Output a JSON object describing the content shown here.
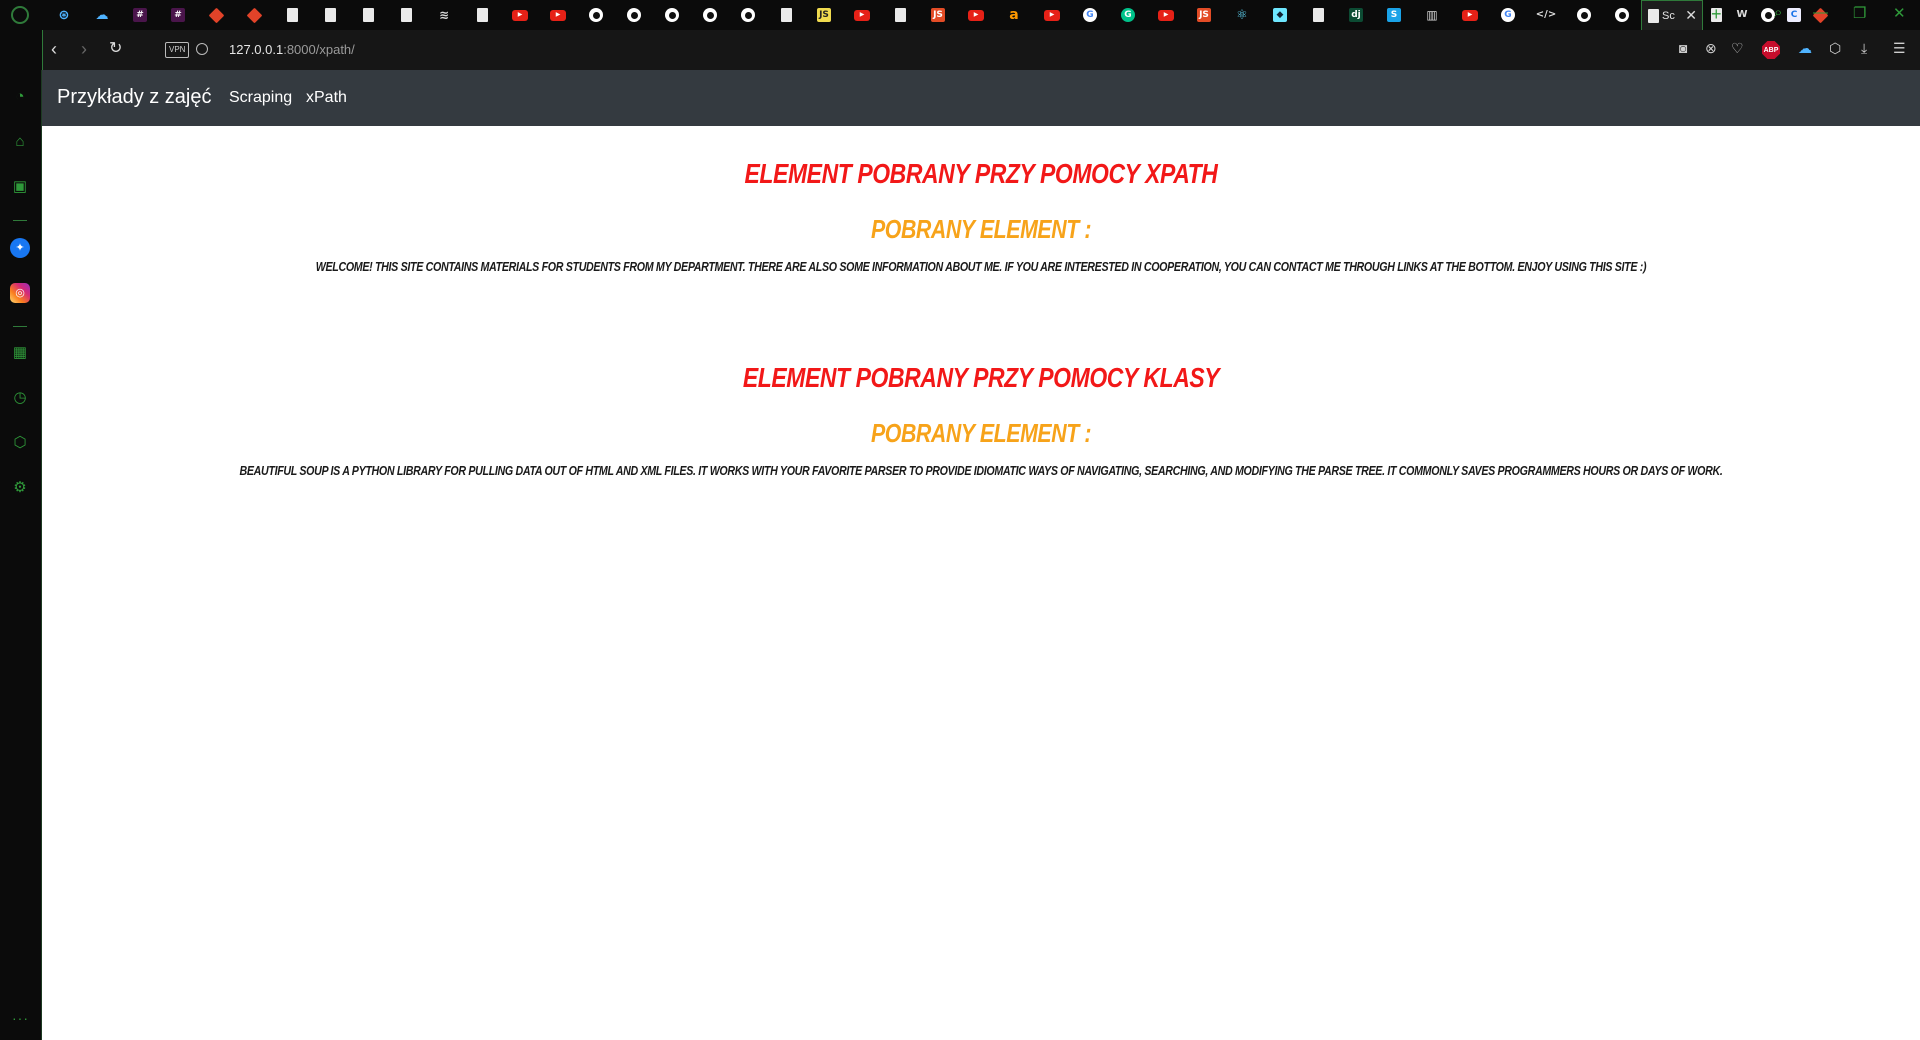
{
  "browser": {
    "tabs": [
      {
        "icon": "gamepad-icon",
        "glyph": "⊛",
        "cls": "cl"
      },
      {
        "icon": "cloud-icon",
        "glyph": "☁",
        "cls": "cl"
      },
      {
        "icon": "slack-icon",
        "glyph": "#",
        "cls": "sl"
      },
      {
        "icon": "slack-icon",
        "glyph": "#",
        "cls": "sl"
      },
      {
        "icon": "gitlab-icon",
        "glyph": "",
        "cls": "gl"
      },
      {
        "icon": "gitlab-icon",
        "glyph": "",
        "cls": "gl"
      },
      {
        "icon": "document-icon",
        "glyph": "",
        "cls": "doc"
      },
      {
        "icon": "document-icon",
        "glyph": "",
        "cls": "doc"
      },
      {
        "icon": "document-icon",
        "glyph": "",
        "cls": "doc"
      },
      {
        "icon": "document-icon",
        "glyph": "",
        "cls": "doc"
      },
      {
        "icon": "stackoverflow-icon",
        "glyph": "≋",
        "cls": "so"
      },
      {
        "icon": "document-icon",
        "glyph": "",
        "cls": "doc"
      },
      {
        "icon": "youtube-icon",
        "glyph": "▶",
        "cls": "yt"
      },
      {
        "icon": "youtube-icon",
        "glyph": "▶",
        "cls": "yt"
      },
      {
        "icon": "github-icon",
        "glyph": "",
        "cls": "gh"
      },
      {
        "icon": "github-icon",
        "glyph": "",
        "cls": "gh"
      },
      {
        "icon": "github-icon",
        "glyph": "",
        "cls": "gh"
      },
      {
        "icon": "github-icon",
        "glyph": "",
        "cls": "gh"
      },
      {
        "icon": "github-icon",
        "glyph": "",
        "cls": "gh"
      },
      {
        "icon": "document-icon",
        "glyph": "",
        "cls": "doc"
      },
      {
        "icon": "javascript-icon",
        "glyph": "JS",
        "cls": "js"
      },
      {
        "icon": "youtube-icon",
        "glyph": "▶",
        "cls": "yt"
      },
      {
        "icon": "document-icon",
        "glyph": "",
        "cls": "doc"
      },
      {
        "icon": "javascript-icon",
        "glyph": "JS",
        "cls": "jsr"
      },
      {
        "icon": "youtube-icon",
        "glyph": "▶",
        "cls": "yt"
      },
      {
        "icon": "amazon-icon",
        "glyph": "a",
        "cls": "am"
      },
      {
        "icon": "youtube-icon",
        "glyph": "▶",
        "cls": "yt"
      },
      {
        "icon": "google-icon",
        "glyph": "G",
        "cls": "g"
      },
      {
        "icon": "grammarly-icon",
        "glyph": "G",
        "cls": "gr"
      },
      {
        "icon": "youtube-icon",
        "glyph": "▶",
        "cls": "yt"
      },
      {
        "icon": "javascript-icon",
        "glyph": "JS",
        "cls": "jsr"
      },
      {
        "icon": "react-icon",
        "glyph": "⚛",
        "cls": "re"
      },
      {
        "icon": "bookmark-icon",
        "glyph": "◆",
        "cls": "b"
      },
      {
        "icon": "document-icon",
        "glyph": "",
        "cls": "doc"
      },
      {
        "icon": "django-icon",
        "glyph": "dj",
        "cls": "dj"
      },
      {
        "icon": "s-icon",
        "glyph": "S",
        "cls": "s"
      },
      {
        "icon": "chart-icon",
        "glyph": "▥",
        "cls": "so"
      },
      {
        "icon": "youtube-icon",
        "glyph": "▶",
        "cls": "yt"
      },
      {
        "icon": "google-icon",
        "glyph": "G",
        "cls": "g"
      },
      {
        "icon": "devtools-icon",
        "glyph": "</>",
        "cls": "dv"
      },
      {
        "icon": "github-icon",
        "glyph": "",
        "cls": "gh"
      },
      {
        "icon": "github-icon",
        "glyph": "",
        "cls": "gh"
      }
    ],
    "active_tab": {
      "title": "Sc",
      "icon": "document-icon"
    },
    "tabs_after": [
      {
        "icon": "document-icon",
        "glyph": "",
        "cls": "doc"
      },
      {
        "icon": "wordpress-icon",
        "glyph": "W",
        "cls": "dv"
      },
      {
        "icon": "github-icon",
        "glyph": "",
        "cls": "gh"
      },
      {
        "icon": "c-icon",
        "glyph": "C",
        "cls": "c"
      },
      {
        "icon": "gitlab-icon",
        "glyph": "",
        "cls": "gl"
      }
    ],
    "address": {
      "host": "127.0.0.1",
      "rest": ":8000/xpath/",
      "vpn_label": "VPN"
    },
    "abp_label": "ABP"
  },
  "site": {
    "brand": "Przykłady z zajęć",
    "nav": [
      {
        "label": "Scraping"
      },
      {
        "label": "xPath"
      }
    ],
    "sections": [
      {
        "heading": "Element pobrany przy pomocy xpath",
        "subheading": "Pobrany element :",
        "text": "Welcome! This site contains materials for students from my department. There are also some information about me. If you are interested in cooperation, you can contact me through links at the bottom. Enjoy using this site :)"
      },
      {
        "heading": "Element pobrany przy pomocy klasy",
        "subheading": "Pobrany element :",
        "text": "Beautiful Soup is a Python library for pulling data out of HTML and XML files. It works with your favorite parser to provide idiomatic ways of navigating, searching, and modifying the parse tree. It commonly saves programmers hours or days of work."
      }
    ]
  },
  "colors": {
    "heading": "#f21818",
    "subheading": "#f7a31a",
    "navbar": "#343a40",
    "opera_accent": "#2f9a3a"
  }
}
